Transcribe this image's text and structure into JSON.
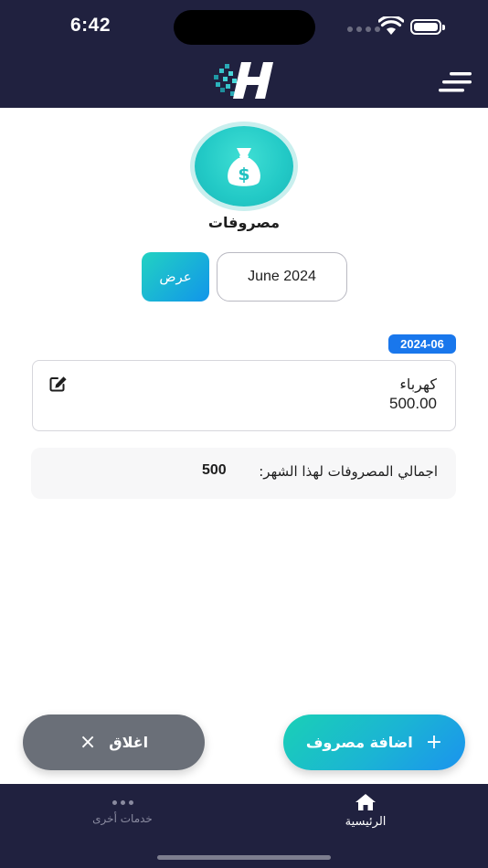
{
  "status_bar": {
    "time": "6:42"
  },
  "header": {
    "logo_icon": "h-logo-icon",
    "menu_icon": "hamburger-menu-icon"
  },
  "page": {
    "icon": "money-bag-icon",
    "title": "مصروفات"
  },
  "filter": {
    "month_value": "June 2024",
    "show_label": "عرض"
  },
  "expenses": [
    {
      "date": "2024-06",
      "name": "كهرباء",
      "amount": "500.00"
    }
  ],
  "summary": {
    "total_label": "اجمالي المصروفات لهذا الشهر:",
    "total_value": "500"
  },
  "actions": {
    "close_label": "اغلاق",
    "add_label": "اضافة مصروف"
  },
  "tabbar": {
    "home_label": "الرئيسية",
    "more_label": "خدمات أخرى"
  },
  "colors": {
    "navy": "#20213f",
    "teal": "#22c9c6",
    "blue": "#1977ec",
    "gray_button": "#6a6f78"
  }
}
